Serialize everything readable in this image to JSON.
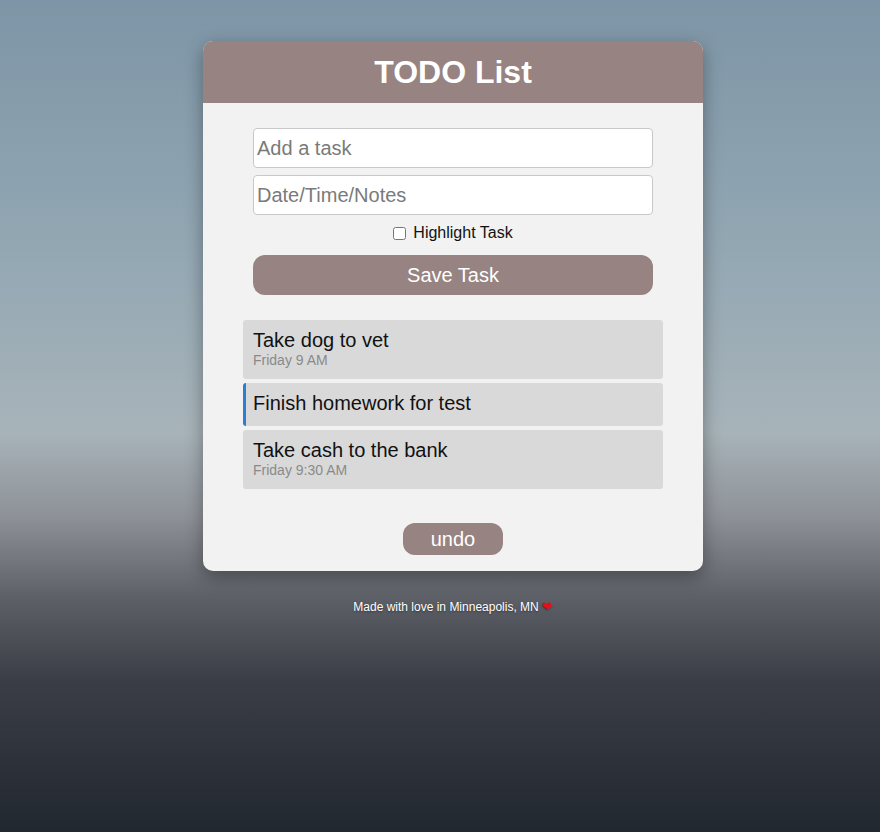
{
  "header": {
    "title": "TODO List"
  },
  "form": {
    "task_placeholder": "Add a task",
    "notes_placeholder": "Date/Time/Notes",
    "highlight": {
      "label": "Highlight Task",
      "checked": false
    },
    "save_button": "Save Task"
  },
  "tasks": [
    {
      "title": "Take dog to vet",
      "notes": "Friday 9 AM",
      "highlighted": false
    },
    {
      "title": "Finish homework for test",
      "notes": "",
      "highlighted": true
    },
    {
      "title": "Take cash to the bank",
      "notes": "Friday 9:30 AM",
      "highlighted": false
    }
  ],
  "undo_button": "undo",
  "footer": {
    "text": "Made with love in Minneapolis, MN",
    "heart": "❤"
  }
}
